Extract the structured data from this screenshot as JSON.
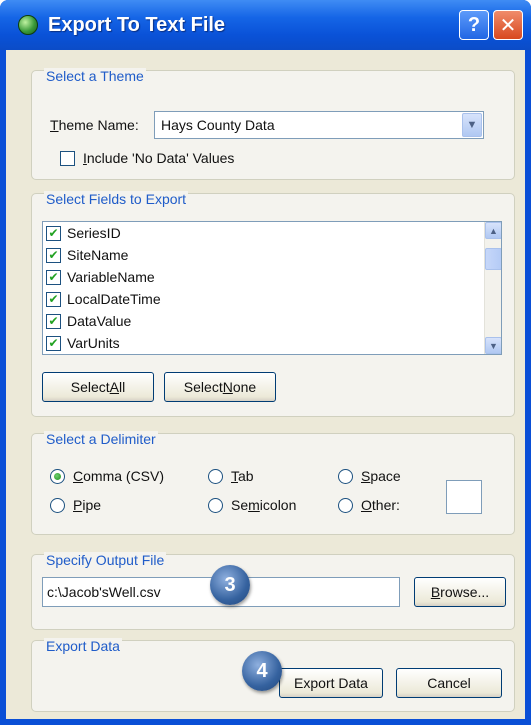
{
  "window": {
    "title": "Export To Text File",
    "help_glyph": "?",
    "close_glyph": "✕"
  },
  "theme": {
    "group_label": "Select a Theme",
    "theme_label_mnemonic": "T",
    "theme_label_rest": "heme Name:",
    "selected_theme": "Hays County Data",
    "nodata_mnemonic": "I",
    "nodata_rest": "nclude 'No Data' Values",
    "nodata_checked": false
  },
  "fields": {
    "group_label": "Select Fields to Export",
    "items": [
      {
        "label": "SeriesID",
        "checked": true
      },
      {
        "label": "SiteName",
        "checked": true
      },
      {
        "label": "VariableName",
        "checked": true
      },
      {
        "label": "LocalDateTime",
        "checked": true
      },
      {
        "label": "DataValue",
        "checked": true
      },
      {
        "label": "VarUnits",
        "checked": true
      }
    ],
    "select_all_prefix": "Select ",
    "select_all_mnemonic": "A",
    "select_all_suffix": "ll",
    "select_none_prefix": "Select ",
    "select_none_mnemonic": "N",
    "select_none_suffix": "one"
  },
  "delimiter": {
    "group_label": "Select a Delimiter",
    "options": [
      {
        "mnemonic": "C",
        "rest": "omma (CSV)",
        "selected": true
      },
      {
        "mnemonic": "T",
        "rest": "ab",
        "selected": false
      },
      {
        "mnemonic": "S",
        "rest": "pace",
        "selected": false
      },
      {
        "mnemonic": "P",
        "rest": "ipe",
        "selected": false
      },
      {
        "prefix": "Se",
        "mnemonic": "m",
        "rest": "icolon",
        "selected": false
      },
      {
        "mnemonic": "O",
        "rest": "ther:",
        "selected": false
      }
    ],
    "other_value": ""
  },
  "output": {
    "group_label": "Specify Output File",
    "path": "c:\\Jacob'sWell.csv",
    "browse_mnemonic": "B",
    "browse_rest": "rowse...",
    "step_badge": "3"
  },
  "export": {
    "group_label": "Export Data",
    "export_label": "Export Data",
    "cancel_label": "Cancel",
    "step_badge": "4"
  },
  "colors": {
    "titlebar": "#0a52d8",
    "group_label": "#1f5cc9",
    "dialog_bg": "#ece9d8",
    "check_mark": "#21a121",
    "badge": "#35629f"
  }
}
